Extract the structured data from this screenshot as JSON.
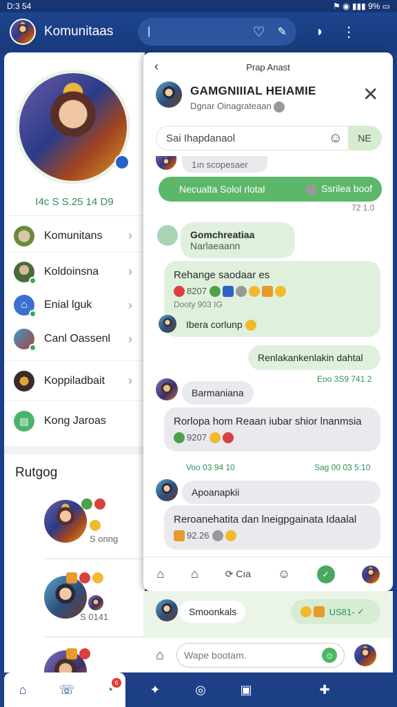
{
  "status": {
    "time": "D:3 54",
    "battery": "9%"
  },
  "appbar": {
    "title": "Komunitaas",
    "search_value": "|"
  },
  "profile": {
    "stat": "I4c S S.25 14 D9"
  },
  "menu": [
    {
      "label": "Komunitans",
      "icon": "community-icon"
    },
    {
      "label": "Koldoinsna",
      "icon": "user-icon"
    },
    {
      "label": "Enial lguk",
      "icon": "mail-icon"
    },
    {
      "label": "Canl Oassenl",
      "icon": "group-icon"
    },
    {
      "label": "Koppiladbait",
      "icon": "shield-icon"
    },
    {
      "label": "Kong Jaroas",
      "icon": "document-icon"
    }
  ],
  "left_section_title": "Rutgog",
  "left_feed": [
    {
      "label": "S onng"
    },
    {
      "label": "S 0141"
    }
  ],
  "chat": {
    "header_label": "Prap Anast",
    "title": "GAMGNIIIAL HEIAMIE",
    "subtitle": "Dgnar Oinagrateaan",
    "search_placeholder": "Sai Ihapdanaol",
    "search_button": "NE",
    "messages": {
      "m1": "1ın scopesaer",
      "m2_left": "Necualta Solol rlotal",
      "m2_right": "Ssrilea boof",
      "m2_ts": "72 1.0",
      "m3_name": "Gomchreatiaa",
      "m3_sub": "Narlaeaann",
      "m4_title": "Rehange saodaar es",
      "m4_line": "8207",
      "m4_meta": "Dooty 903 IG",
      "m4_last": "Ibera corlunp",
      "m5": "Renlakankenlakin dahtal",
      "m5_ts": "Eoo 3S9 741 2",
      "m6_name": "Barmaniana",
      "m6_text": "Rorlopa hom Reaan iubar shior lnanmsia",
      "m6_line": "9207",
      "ts_left": "Voo 03 94 10",
      "ts_right": "Sag 00 03 5:10",
      "m7_name": "Apoanapkii",
      "m7_text": "Reroanehatita dan lneigpgainata Idaalal",
      "m7_line": "92.26"
    },
    "toolbar_badge": "Cıa"
  },
  "bottom_chat": {
    "name": "Smoonkals",
    "right_text": "US81-",
    "input_placeholder": "Wape bootam."
  },
  "nav": {
    "badge": "6"
  }
}
